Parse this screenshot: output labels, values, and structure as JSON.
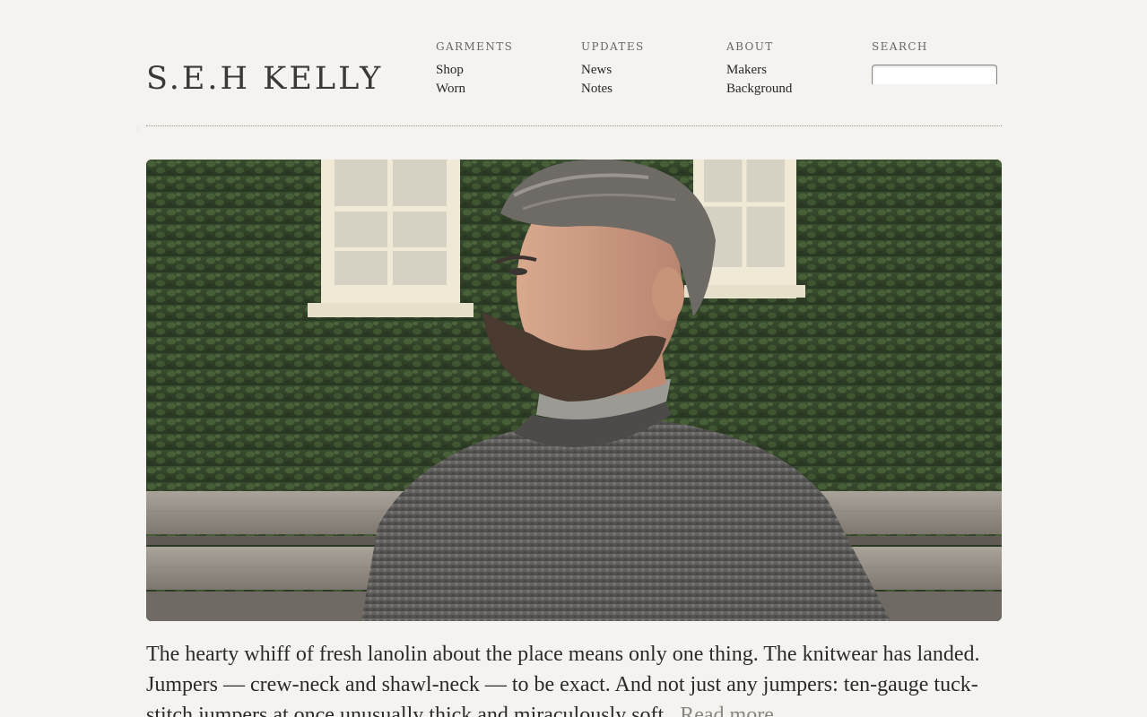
{
  "brand": {
    "logo_text": "S.E.H KELLY"
  },
  "nav": {
    "garments": {
      "title": "GARMENTS",
      "links": [
        "Shop",
        "Worn"
      ]
    },
    "updates": {
      "title": "UPDATES",
      "links": [
        "News",
        "Notes"
      ]
    },
    "about": {
      "title": "ABOUT",
      "links": [
        "Makers",
        "Background"
      ]
    },
    "search": {
      "title": "SEARCH",
      "value": "",
      "placeholder": ""
    }
  },
  "article": {
    "intro_text": "The hearty whiff of fresh lanolin about the place means only one thing. The knitwear has landed. Jumpers — crew-neck and shawl-neck — to be exact. And not just any jumpers: ten-gauge tuck-stitch jumpers at once unusually thick and miraculously soft.",
    "read_more": "Read more"
  },
  "colors": {
    "background": "#f4f3f0",
    "text": "#2d2a28",
    "nav_title": "#6b6764",
    "read_more": "#8a8682"
  }
}
